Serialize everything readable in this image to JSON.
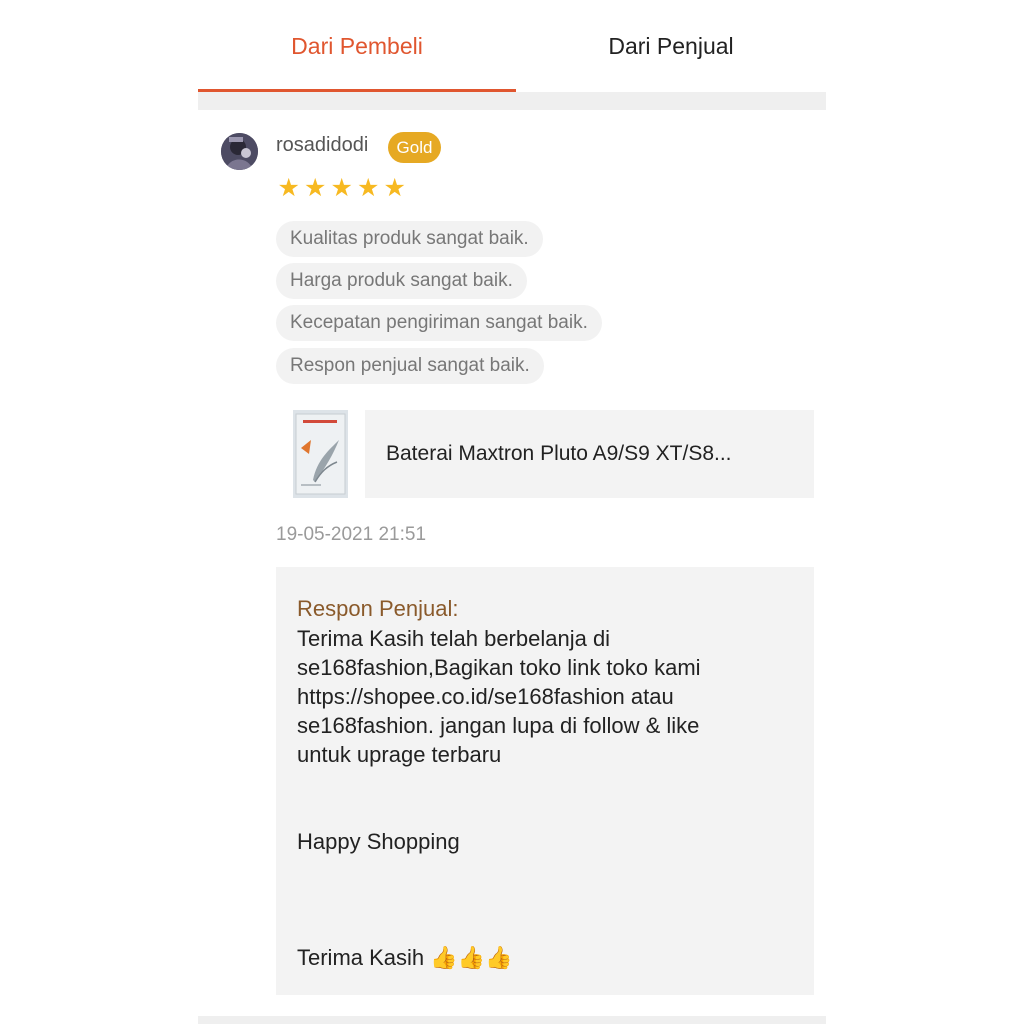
{
  "tabs": {
    "buyer": "Dari Pembeli",
    "seller": "Dari Penjual",
    "active_color": "#e0562f"
  },
  "review": {
    "username": "rosadidodi",
    "badge": "Gold",
    "badge_color": "#e6a923",
    "rating": 5,
    "rating_max": 5,
    "star_color": "#f7b921",
    "chips": [
      "Kualitas produk sangat baik.",
      "Harga produk sangat baik.",
      "Kecepatan pengiriman sangat baik.",
      "Respon penjual sangat baik."
    ],
    "product_name": "Baterai Maxtron Pluto A9/S9 XT/S8...",
    "timestamp": "19-05-2021 21:51"
  },
  "seller_response": {
    "title": "Respon Penjual:",
    "body": "Terima Kasih telah berbelanja di\nse168fashion,Bagikan toko link toko kami\nhttps://shopee.co.id/se168fashion atau\nse168fashion. jangan lupa di follow & like\nuntuk uprage terbaru\n\n\nHappy Shopping\n\n\n\nTerima Kasih 👍👍👍"
  }
}
